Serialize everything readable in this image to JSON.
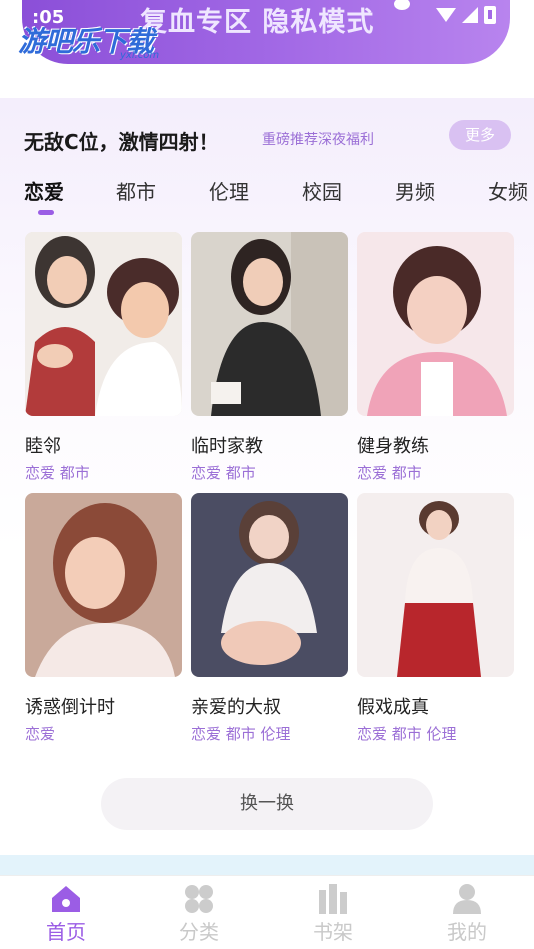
{
  "status_bar": {
    "time": ":05"
  },
  "banner": {
    "text": "复血专区 隐私模式"
  },
  "watermark": {
    "text": "游吧乐下载",
    "sub": "yxl.com"
  },
  "section": {
    "title": "无敌C位，激情四射！",
    "subtitle": "重磅推荐深夜福利",
    "more_label": "更多"
  },
  "tabs": [
    {
      "label": "恋爱"
    },
    {
      "label": "都市"
    },
    {
      "label": "伦理"
    },
    {
      "label": "校园"
    },
    {
      "label": "男频"
    },
    {
      "label": "女频"
    }
  ],
  "active_tab": "恋爱",
  "books": [
    {
      "title": "睦邻",
      "tags": "恋爱 都市"
    },
    {
      "title": "临时家教",
      "tags": "恋爱 都市"
    },
    {
      "title": "健身教练",
      "tags": "恋爱 都市"
    },
    {
      "title": "诱惑倒计时",
      "tags": "恋爱"
    },
    {
      "title": "亲爱的大叔",
      "tags": "恋爱 都市 伦理"
    },
    {
      "title": "假戏成真",
      "tags": "恋爱 都市 伦理"
    }
  ],
  "refresh_label": "换一换",
  "bottom_nav": [
    {
      "label": "首页",
      "icon": "home-icon"
    },
    {
      "label": "分类",
      "icon": "category-icon"
    },
    {
      "label": "书架",
      "icon": "bookshelf-icon"
    },
    {
      "label": "我的",
      "icon": "profile-icon"
    }
  ],
  "colors": {
    "accent": "#9b5de5",
    "tag": "#9b6fd6",
    "banner": "#a36ae6"
  }
}
